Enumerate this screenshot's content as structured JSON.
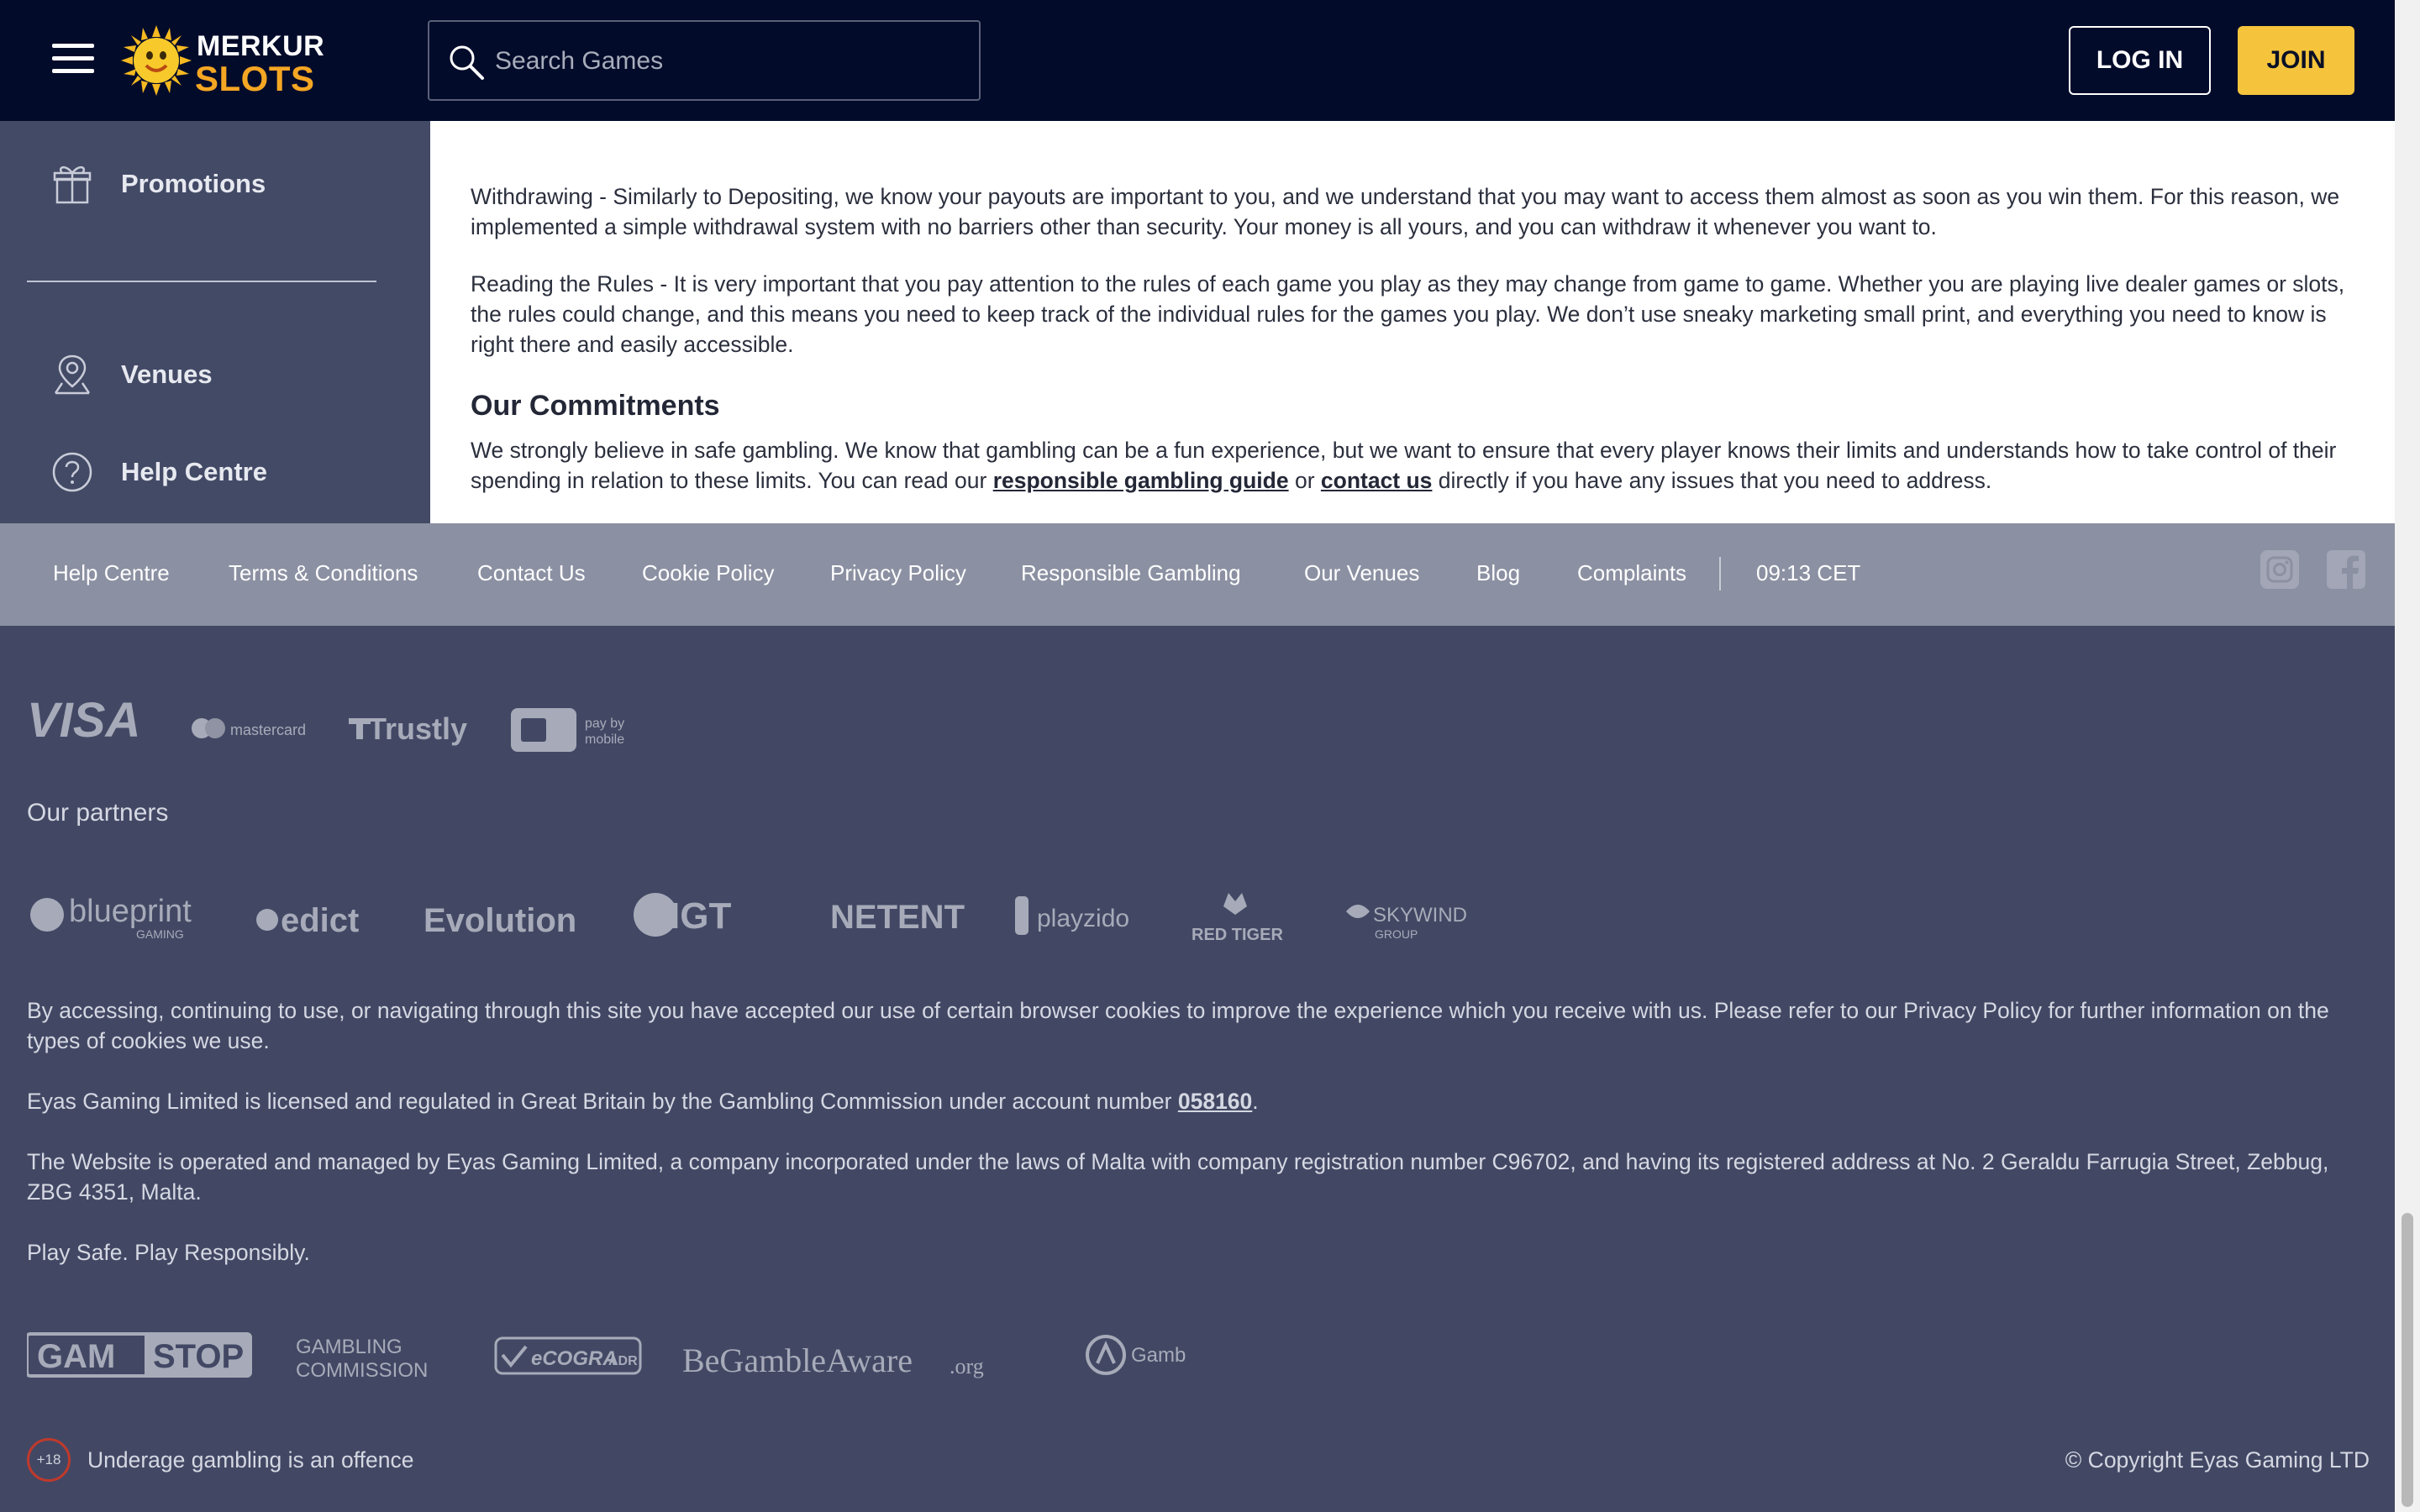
{
  "header": {
    "brand_line1": "MERKUR",
    "brand_line2": "SLOTS",
    "search_placeholder": "Search Games",
    "login_label": "LOG IN",
    "join_label": "JOIN",
    "colors": {
      "background": "#020b2a",
      "join": "#f5c43c",
      "brand_orange": "#f5a623"
    }
  },
  "sidebar": {
    "items": [
      {
        "label": "Promotions",
        "icon": "gift-icon"
      },
      {
        "label": "Venues",
        "icon": "map-pin-icon"
      },
      {
        "label": "Help Centre",
        "icon": "question-circle-icon"
      }
    ]
  },
  "main": {
    "withdrawing": "Withdrawing - Similarly to Depositing,  we know your payouts are important to you, and we understand that you may want to access them almost as soon as you win them. For this reason, we implemented a simple withdrawal system with no barriers other than security. Your money is all yours, and you can withdraw it whenever you want to.",
    "reading_rules": "Reading the Rules - It is very important that you pay attention to the rules of each game you play as they may change from game to game. Whether you are playing live dealer games or slots, the rules could change, and this means you need to keep track of the individual rules for the games you play. We don’t use sneaky marketing small print, and everything you need to know is right there and easily accessible.",
    "commitments_heading": "Our Commitments",
    "commitments_text_1": "We strongly believe in safe gambling. We know that gambling can be a fun experience, but we want to ensure that every player knows their limits and understands how to take control of their spending in relation to these limits. You can read our ",
    "commitments_link_1": "responsible gambling guide",
    "commitments_text_2": " or ",
    "commitments_link_2": "contact us",
    "commitments_text_3": " directly if you have any issues that you need to address."
  },
  "footer_nav": {
    "links": [
      "Help Centre",
      "Terms & Conditions",
      "Contact Us",
      "Cookie Policy",
      "Privacy Policy",
      "Responsible Gambling",
      "Our Venues",
      "Blog",
      "Complaints"
    ],
    "time": "09:13 CET",
    "social": [
      "instagram-icon",
      "facebook-icon"
    ]
  },
  "footer": {
    "payment_logos": [
      "VISA",
      "mastercard",
      "Trustly",
      "pay by",
      "mobile"
    ],
    "partners_title": "Our partners",
    "partner_logos": [
      "blueprint",
      "GAMING",
      "edict",
      "Evolution",
      "IGT",
      "NETENT",
      "playzido",
      "RED TIGER",
      "SKYWIND",
      "GROUP"
    ],
    "cookies_text": "By accessing, continuing to use, or navigating through this site you have accepted our use of certain browser cookies to improve the experience which you receive with us. Please refer to our Privacy Policy for further information on the types of cookies we use.",
    "license_text_1": "Eyas Gaming Limited is licensed and regulated in Great Britain by the Gambling Commission under account number ",
    "license_number": "058160",
    "license_text_2": ".",
    "operator_text": "The Website is operated and managed by Eyas Gaming Limited, a company incorporated under the laws of Malta with company registration number C96702, and having its registered address at No. 2 Geraldu Farrugia Street, Zebbug, ZBG 4351, Malta.",
    "play_safe": "Play Safe. Play Responsibly.",
    "regulator_logos": [
      "GAM",
      "STOP",
      "GAMBLING",
      "COMMISSION",
      "eCOGRA",
      "ADR",
      "BeGambleAware",
      ".org",
      "Gamban"
    ],
    "age_badge": "+18",
    "age_text": "Underage gambling is an offence",
    "copyright": "© Copyright Eyas Gaming LTD"
  }
}
